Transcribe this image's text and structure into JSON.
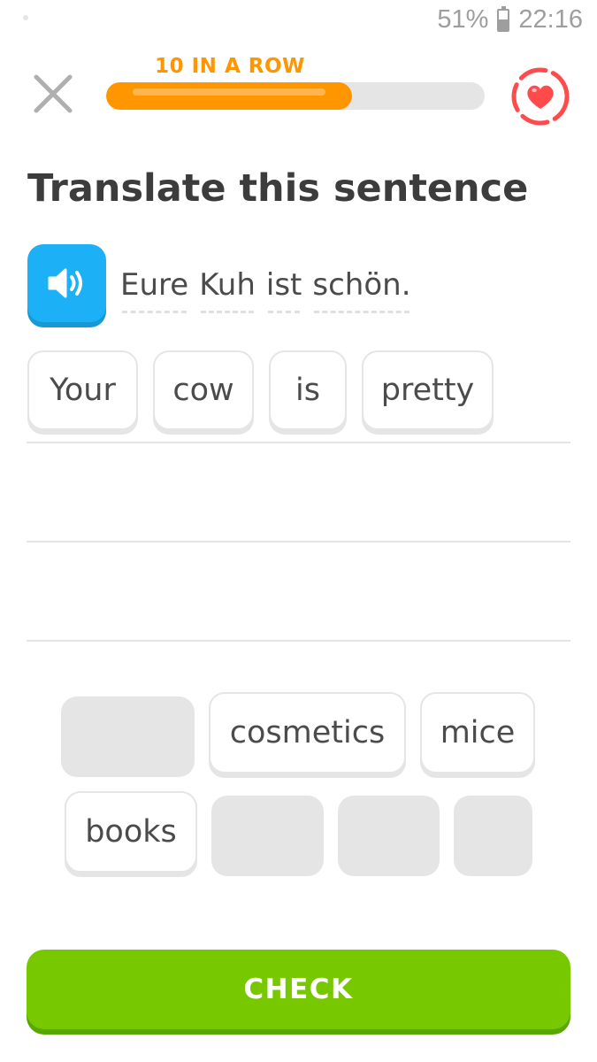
{
  "status_bar": {
    "battery": "51%",
    "battery_level": 0.51,
    "time": "22:16"
  },
  "header": {
    "close_icon": "close-icon",
    "streak_label": "10 IN A ROW",
    "progress_fraction": 0.65,
    "hearts_icon": "heart-icon"
  },
  "exercise": {
    "title": "Translate this sentence",
    "speaker_icon": "speaker-icon",
    "prompt_words": [
      "Eure",
      "Kuh",
      "ist",
      "schön."
    ]
  },
  "answer": {
    "words": [
      "Your",
      "cow",
      "is",
      "pretty"
    ]
  },
  "word_bank": {
    "available": [
      "cosmetics",
      "mice",
      "books"
    ]
  },
  "footer": {
    "check_label": "CHECK"
  },
  "colors": {
    "accent_orange": "#ff9600",
    "speaker_blue": "#1cb0f6",
    "check_green": "#78c800",
    "heart_red": "#ff4b4b"
  }
}
